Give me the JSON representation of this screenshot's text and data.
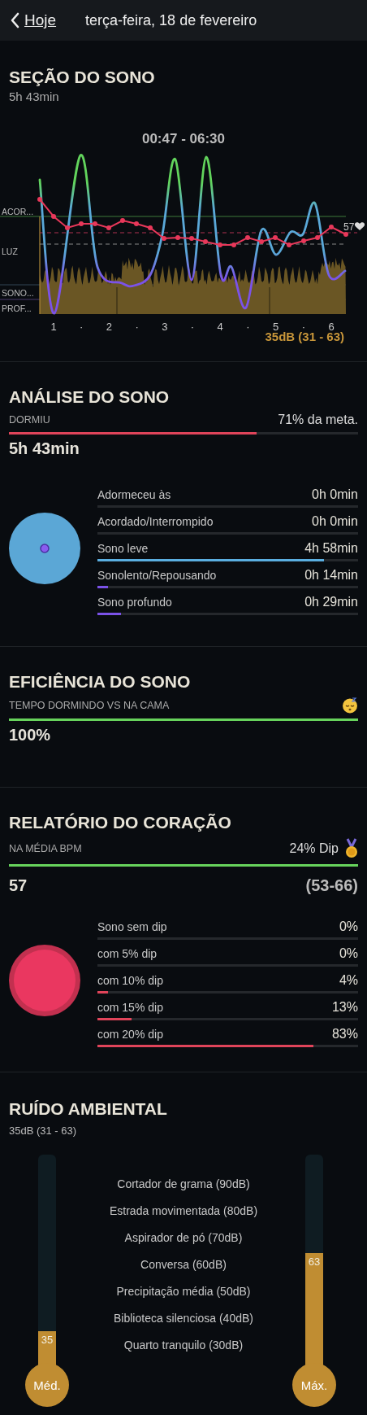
{
  "nav": {
    "back_label": "Hoje",
    "title": "terça-feira, 18 de fevereiro"
  },
  "sleep_section": {
    "title": "SEÇÃO DO SONO",
    "duration": "5h 43min",
    "time_range": "00:47 - 06:30",
    "y_labels": [
      "ACOR...",
      "LUZ",
      "SONO...",
      "PROF..."
    ],
    "heart_rate_label": "57",
    "x_labels": [
      "1",
      "·",
      "2",
      "·",
      "3",
      "·",
      "4",
      "·",
      "5",
      "·",
      "6"
    ],
    "noise_summary": "35dB (31 - 63)"
  },
  "analysis": {
    "title": "ANÁLISE DO SONO",
    "goal_label": "DORMIU",
    "goal_text": "71% da meta.",
    "level": 0.71,
    "total": "5h 43min",
    "rows": [
      {
        "label": "Adormeceu às",
        "value": "0h 0min"
      },
      {
        "label": "Acordado/Interrompido",
        "value": "0h 0min"
      },
      {
        "label": "Sono leve",
        "value": "4h 58min",
        "level": 0.87,
        "color": "#5aaee0"
      },
      {
        "label": "Sonolento/Repousando",
        "value": "0h 14min",
        "level": 0.04,
        "color": "#7b52e8"
      },
      {
        "label": "Sono profundo",
        "value": "0h 29min",
        "level": 0.09,
        "color": "#7b52e8"
      }
    ]
  },
  "efficiency": {
    "title": "EFICIÊNCIA DO SONO",
    "subtitle": "TEMPO DORMINDO VS NA CAMA",
    "level": 1,
    "value": "100%"
  },
  "heart": {
    "title": "RELATÓRIO DO CORAÇÃO",
    "subtitle": "NA MÉDIA BPM",
    "dip": "24% Dip",
    "level": 1,
    "average": "57",
    "range": "(53-66)",
    "rows": [
      {
        "label": "Sono sem dip",
        "value": "0%"
      },
      {
        "label": "com 5% dip",
        "value": "0%"
      },
      {
        "label": "com 10% dip",
        "value": "4%",
        "level": 0.04
      },
      {
        "label": "com 15% dip",
        "value": "13%",
        "level": 0.13
      },
      {
        "label": "com 20% dip",
        "value": "83%",
        "level": 0.83
      }
    ]
  },
  "noise": {
    "title": "RUÍDO AMBIENTAL",
    "summary": "35dB (31 - 63)",
    "references": [
      "Cortador de grama (90dB)",
      "Estrada movimentada (80dB)",
      "Aspirador de pó (70dB)",
      "Conversa (60dB)",
      "Precipitação média (50dB)",
      "Biblioteca silenciosa (40dB)",
      "Quarto tranquilo (30dB)"
    ],
    "gauges": [
      {
        "label": "Méd.",
        "reading": "35",
        "level": 0.17
      },
      {
        "label": "Máx.",
        "reading": "63",
        "level": 0.54
      }
    ]
  }
}
